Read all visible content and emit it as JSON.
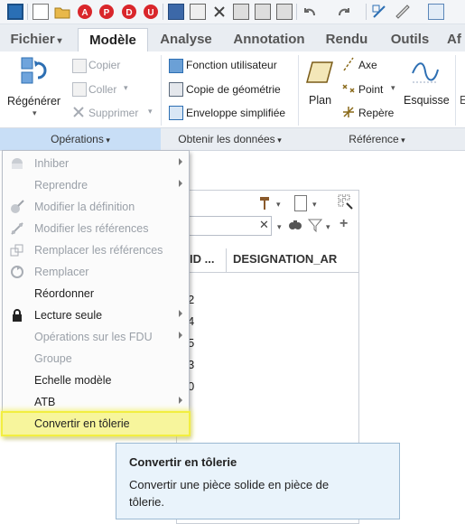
{
  "ribbon_tabs": [
    "Fichier",
    "Modèle",
    "Analyse",
    "Annotation",
    "Rendu",
    "Outils",
    "Af"
  ],
  "ribbon": {
    "regenerate": "Régénérer",
    "copy": "Copier",
    "paste": "Coller",
    "delete": "Supprimer",
    "user_function": "Fonction utilisateur",
    "geometry_copy": "Copie de géométrie",
    "simplified_envelope": "Enveloppe simplifiée",
    "plane": "Plan",
    "axis": "Axe",
    "point": "Point",
    "csys": "Repère",
    "sketch": "Esquisse"
  },
  "groups": {
    "operations": "Opérations",
    "get_data": "Obtenir les données",
    "reference": "Référence"
  },
  "panel": {
    "col_id": "ID ...",
    "col_designation": "DESIGNATION_AR",
    "row_fragments": [
      "2",
      "4",
      "5",
      "3",
      "0"
    ]
  },
  "menu_items": [
    {
      "label": "Inhiber",
      "enabled": false,
      "submenu": true
    },
    {
      "label": "Reprendre",
      "enabled": false,
      "submenu": true
    },
    {
      "label": "Modifier la définition",
      "enabled": false,
      "submenu": false
    },
    {
      "label": "Modifier les références",
      "enabled": false,
      "submenu": false
    },
    {
      "label": "Remplacer les références",
      "enabled": false,
      "submenu": false
    },
    {
      "label": "Remplacer",
      "enabled": false,
      "submenu": false
    },
    {
      "label": "Réordonner",
      "enabled": true,
      "submenu": false
    },
    {
      "label": "Lecture seule",
      "enabled": true,
      "submenu": true
    },
    {
      "label": "Opérations sur les FDU",
      "enabled": false,
      "submenu": true
    },
    {
      "label": "Groupe",
      "enabled": false,
      "submenu": false
    },
    {
      "label": "Echelle modèle",
      "enabled": true,
      "submenu": false
    },
    {
      "label": "ATB",
      "enabled": true,
      "submenu": true
    },
    {
      "label": "Convertir en tôlerie",
      "enabled": true,
      "submenu": false,
      "highlighted": true
    }
  ],
  "tooltip": {
    "title": "Convertir en tôlerie",
    "body_line1": "Convertir une pièce solide en pièce de",
    "body_line2": "tôlerie."
  },
  "colors": {
    "highlight": "#f7f59c",
    "tooltip_bg": "#e9f3fb",
    "group_active": "#c8def6"
  }
}
